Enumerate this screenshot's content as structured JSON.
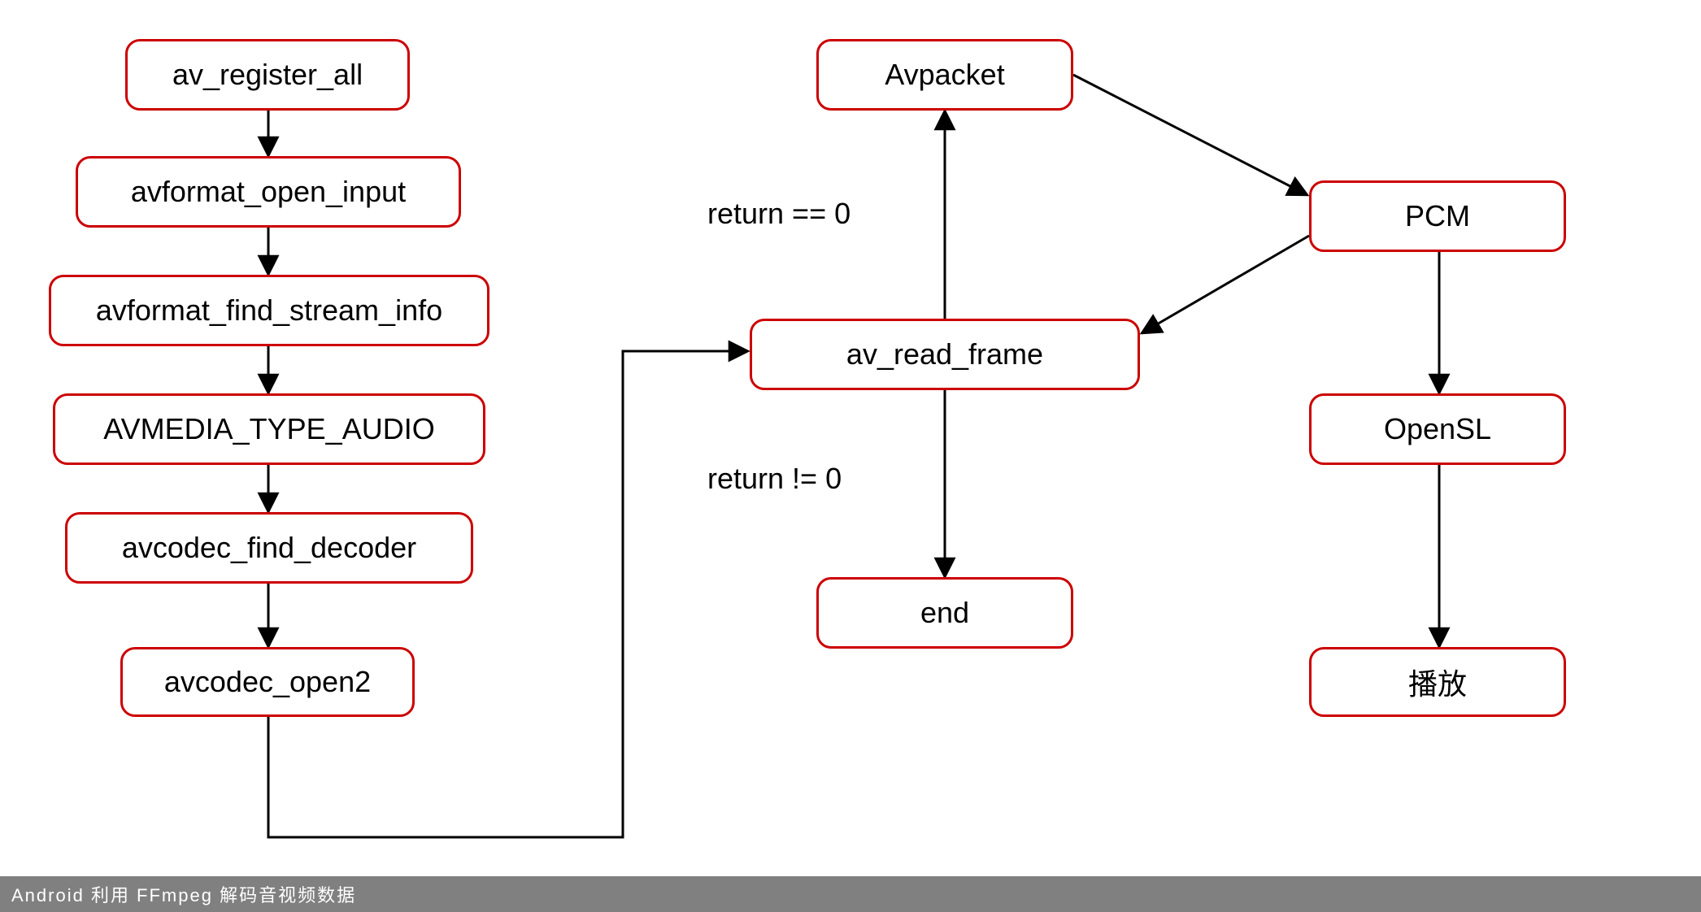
{
  "nodes": {
    "n1": "av_register_all",
    "n2": "avformat_open_input",
    "n3": "avformat_find_stream_info",
    "n4": "AVMEDIA_TYPE_AUDIO",
    "n5": "avcodec_find_decoder",
    "n6": "avcodec_open2",
    "n7": "Avpacket",
    "n8": "av_read_frame",
    "n9": "end",
    "n10": "PCM",
    "n11": "OpenSL",
    "n12": "播放"
  },
  "edge_labels": {
    "ret0": "return == 0",
    "retn0": "return != 0"
  },
  "caption": "Android 利用 FFmpeg 解码音视频数据",
  "colors": {
    "node_border": "#CC0000",
    "node_fill": "#FFFFFF",
    "text": "#000000",
    "caption_bg": "#808080",
    "caption_text": "#FFFFFF",
    "edge": "#000000"
  }
}
